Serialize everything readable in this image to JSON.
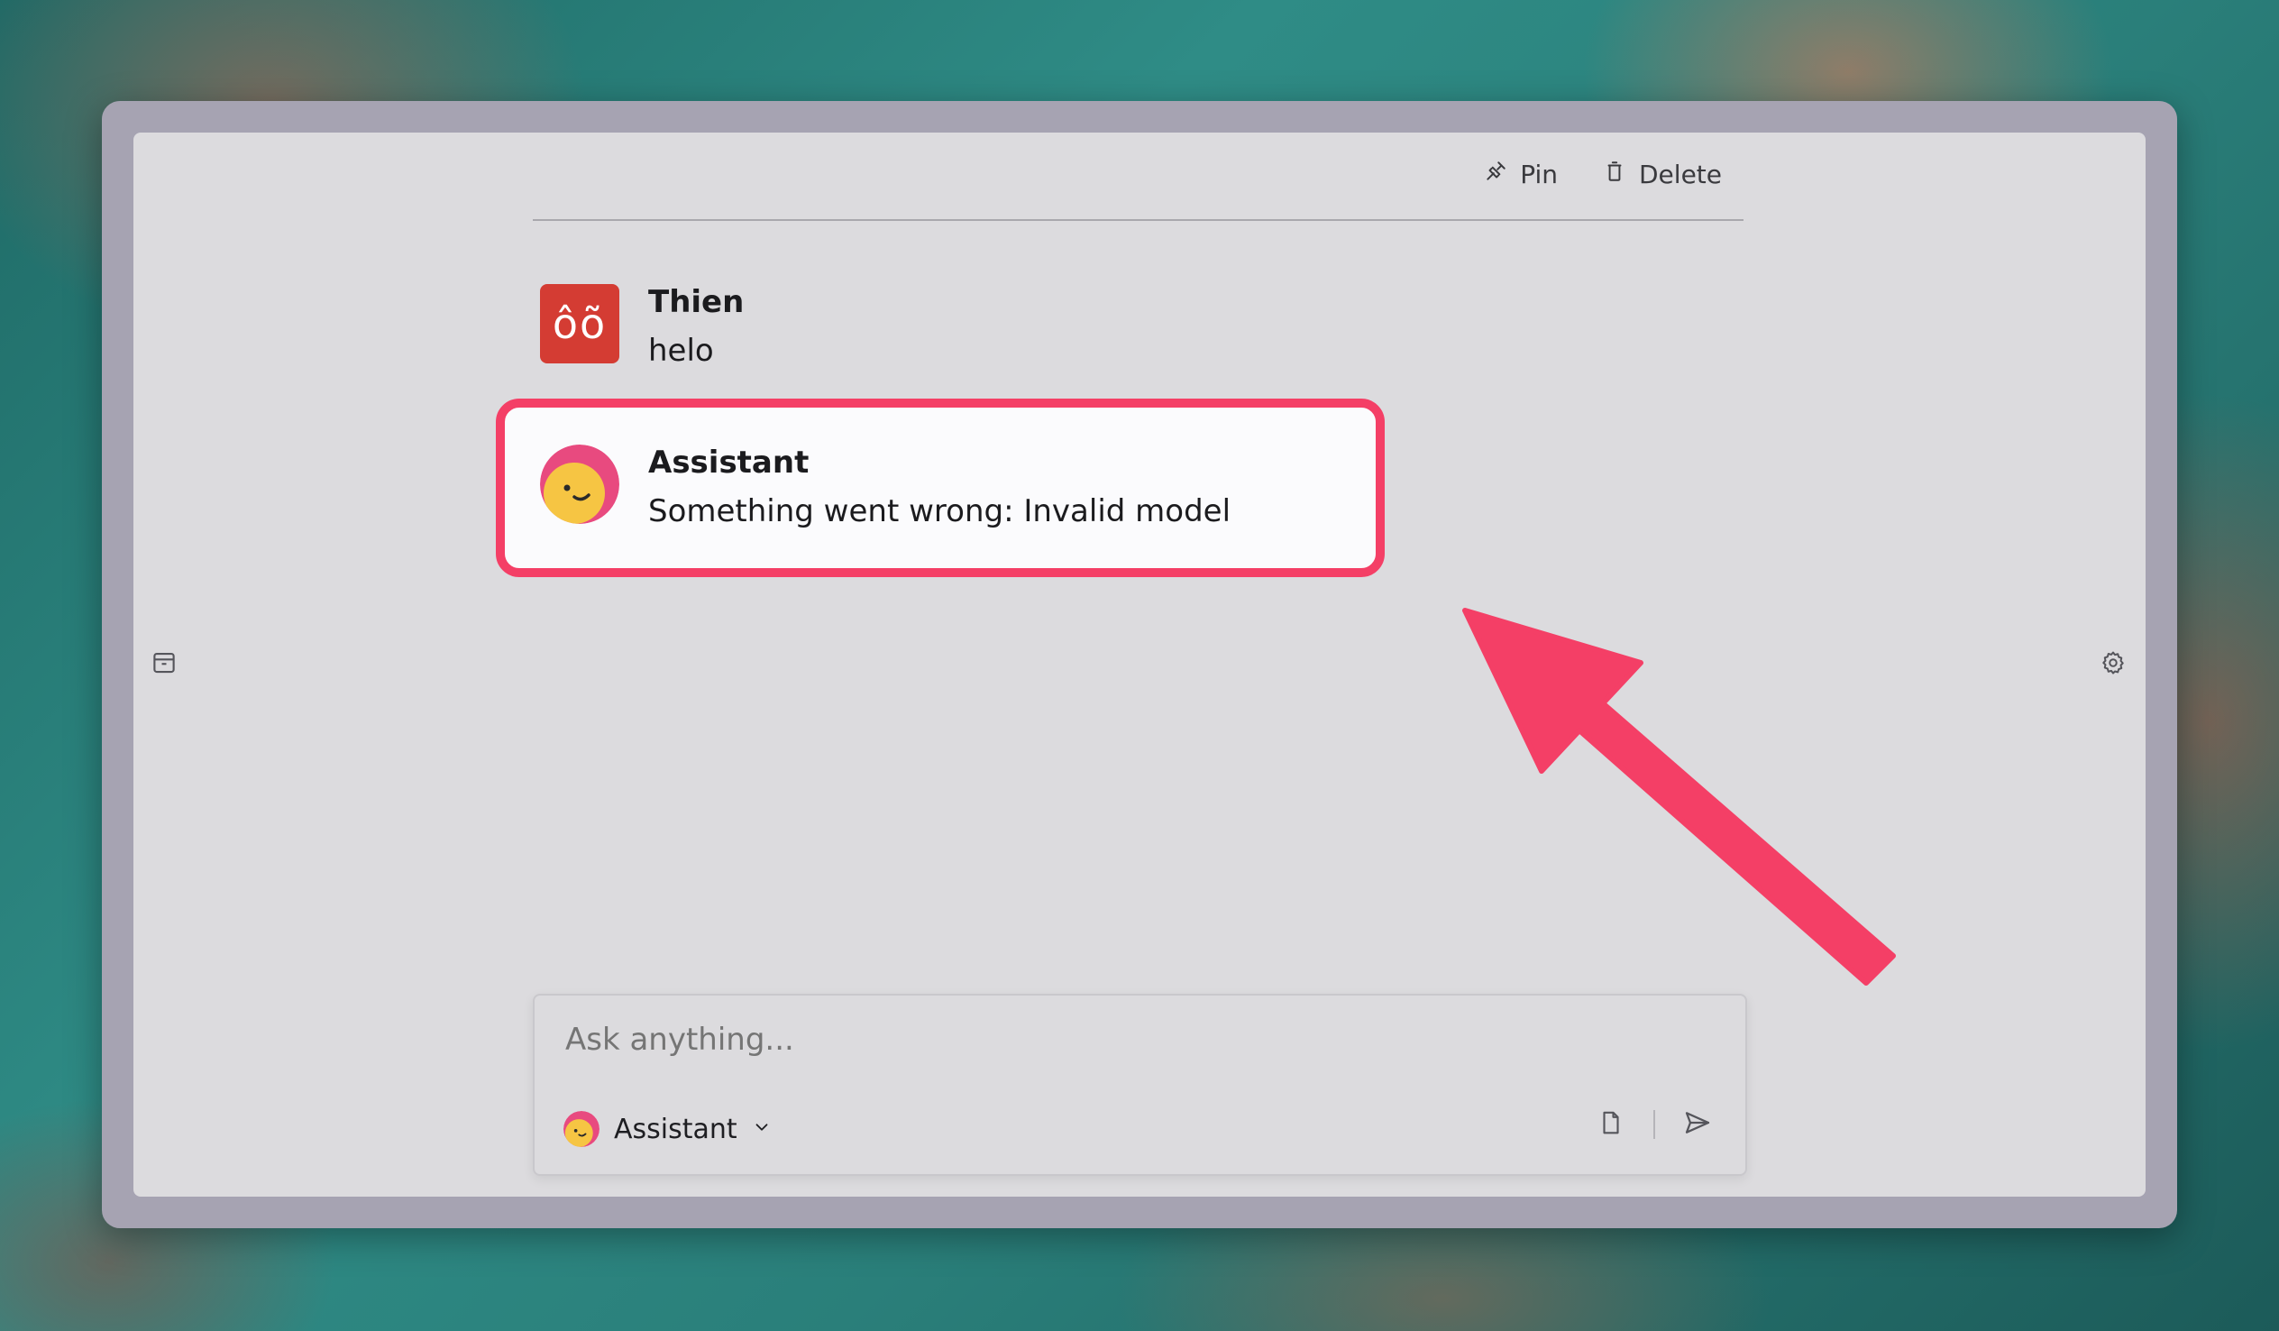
{
  "toolbar": {
    "pin_label": "Pin",
    "delete_label": "Delete"
  },
  "messages": [
    {
      "sender": "Thien",
      "avatar_text": "ôõ",
      "text": "helo"
    },
    {
      "sender": "Assistant",
      "text": "Something went wrong: Invalid model"
    }
  ],
  "composer": {
    "placeholder": "Ask anything...",
    "model_label": "Assistant"
  },
  "colors": {
    "accent": "#f43f66",
    "user_avatar": "#d43c33",
    "assistant_avatar_top": "#e84a7f",
    "assistant_avatar_face": "#f6c543"
  }
}
